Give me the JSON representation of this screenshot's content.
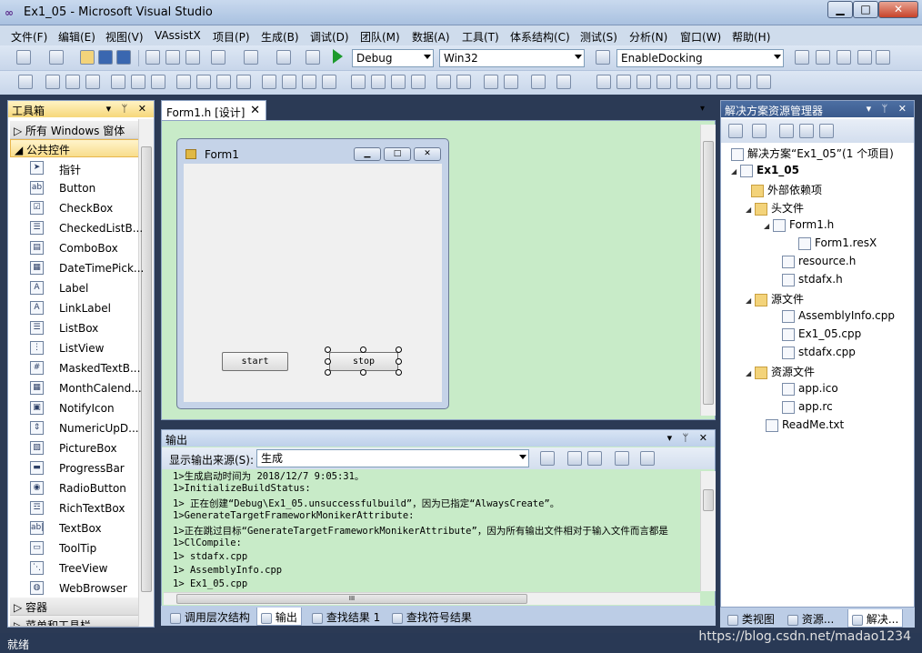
{
  "window": {
    "title": "Ex1_05 - Microsoft Visual Studio",
    "min": "▁",
    "max": "□",
    "close": "✕"
  },
  "menu": [
    "文件(F)",
    "编辑(E)",
    "视图(V)",
    "VAssistX",
    "项目(P)",
    "生成(B)",
    "调试(D)",
    "团队(M)",
    "数据(A)",
    "工具(T)",
    "体系结构(C)",
    "测试(S)",
    "分析(N)",
    "窗口(W)",
    "帮助(H)"
  ],
  "toolbar": {
    "config": "Debug",
    "platform": "Win32",
    "find": "EnableDocking"
  },
  "toolbox": {
    "title": "工具箱",
    "hdr_buttons": "▾ ᛘ ✕",
    "cat_all": "所有 Windows 窗体",
    "cat_common": "公共控件",
    "cat_containers": "容器",
    "cat_menus": "菜单和工具栏",
    "items": [
      "指针",
      "Button",
      "CheckBox",
      "CheckedListB...",
      "ComboBox",
      "DateTimePick...",
      "Label",
      "LinkLabel",
      "ListBox",
      "ListView",
      "MaskedTextB...",
      "MonthCalend...",
      "NotifyIcon",
      "NumericUpD...",
      "PictureBox",
      "ProgressBar",
      "RadioButton",
      "RichTextBox",
      "TextBox",
      "ToolTip",
      "TreeView",
      "WebBrowser"
    ]
  },
  "doc_tab": {
    "label": "Form1.h [设计]",
    "close": "✕"
  },
  "form": {
    "title": "Form1",
    "start": "start",
    "stop": "stop"
  },
  "output": {
    "title": "输出",
    "source_label": "显示输出来源(S):",
    "source_value": "生成",
    "lines": [
      "1>生成启动时间为 2018/12/7 9:05:31。",
      "1>InitializeBuildStatus:",
      "1>  正在创建“Debug\\Ex1_05.unsuccessfulbuild”，因为已指定“AlwaysCreate”。",
      "1>GenerateTargetFrameworkMonikerAttribute:",
      "1>正在跳过目标“GenerateTargetFrameworkMonikerAttribute”，因为所有输出文件相对于输入文件而言都是",
      "1>ClCompile:",
      "1>  stdafx.cpp",
      "1>  AssemblyInfo.cpp",
      "1>  Ex1_05.cpp"
    ]
  },
  "bottom_tabs": [
    "调用层次结构",
    "输出",
    "查找结果 1",
    "查找符号结果"
  ],
  "solution": {
    "title": "解决方案资源管理器",
    "root": "解决方案“Ex1_05”(1 个项目)",
    "project": "Ex1_05",
    "nodes": [
      "外部依赖项",
      "头文件",
      "Form1.h",
      "Form1.resX",
      "resource.h",
      "stdafx.h",
      "源文件",
      "AssemblyInfo.cpp",
      "Ex1_05.cpp",
      "stdafx.cpp",
      "资源文件",
      "app.ico",
      "app.rc",
      "ReadMe.txt"
    ]
  },
  "right_tabs": [
    "类视图",
    "资源...",
    "解决..."
  ],
  "status": {
    "text": "就绪",
    "watermark": "https://blog.csdn.net/madao1234"
  }
}
